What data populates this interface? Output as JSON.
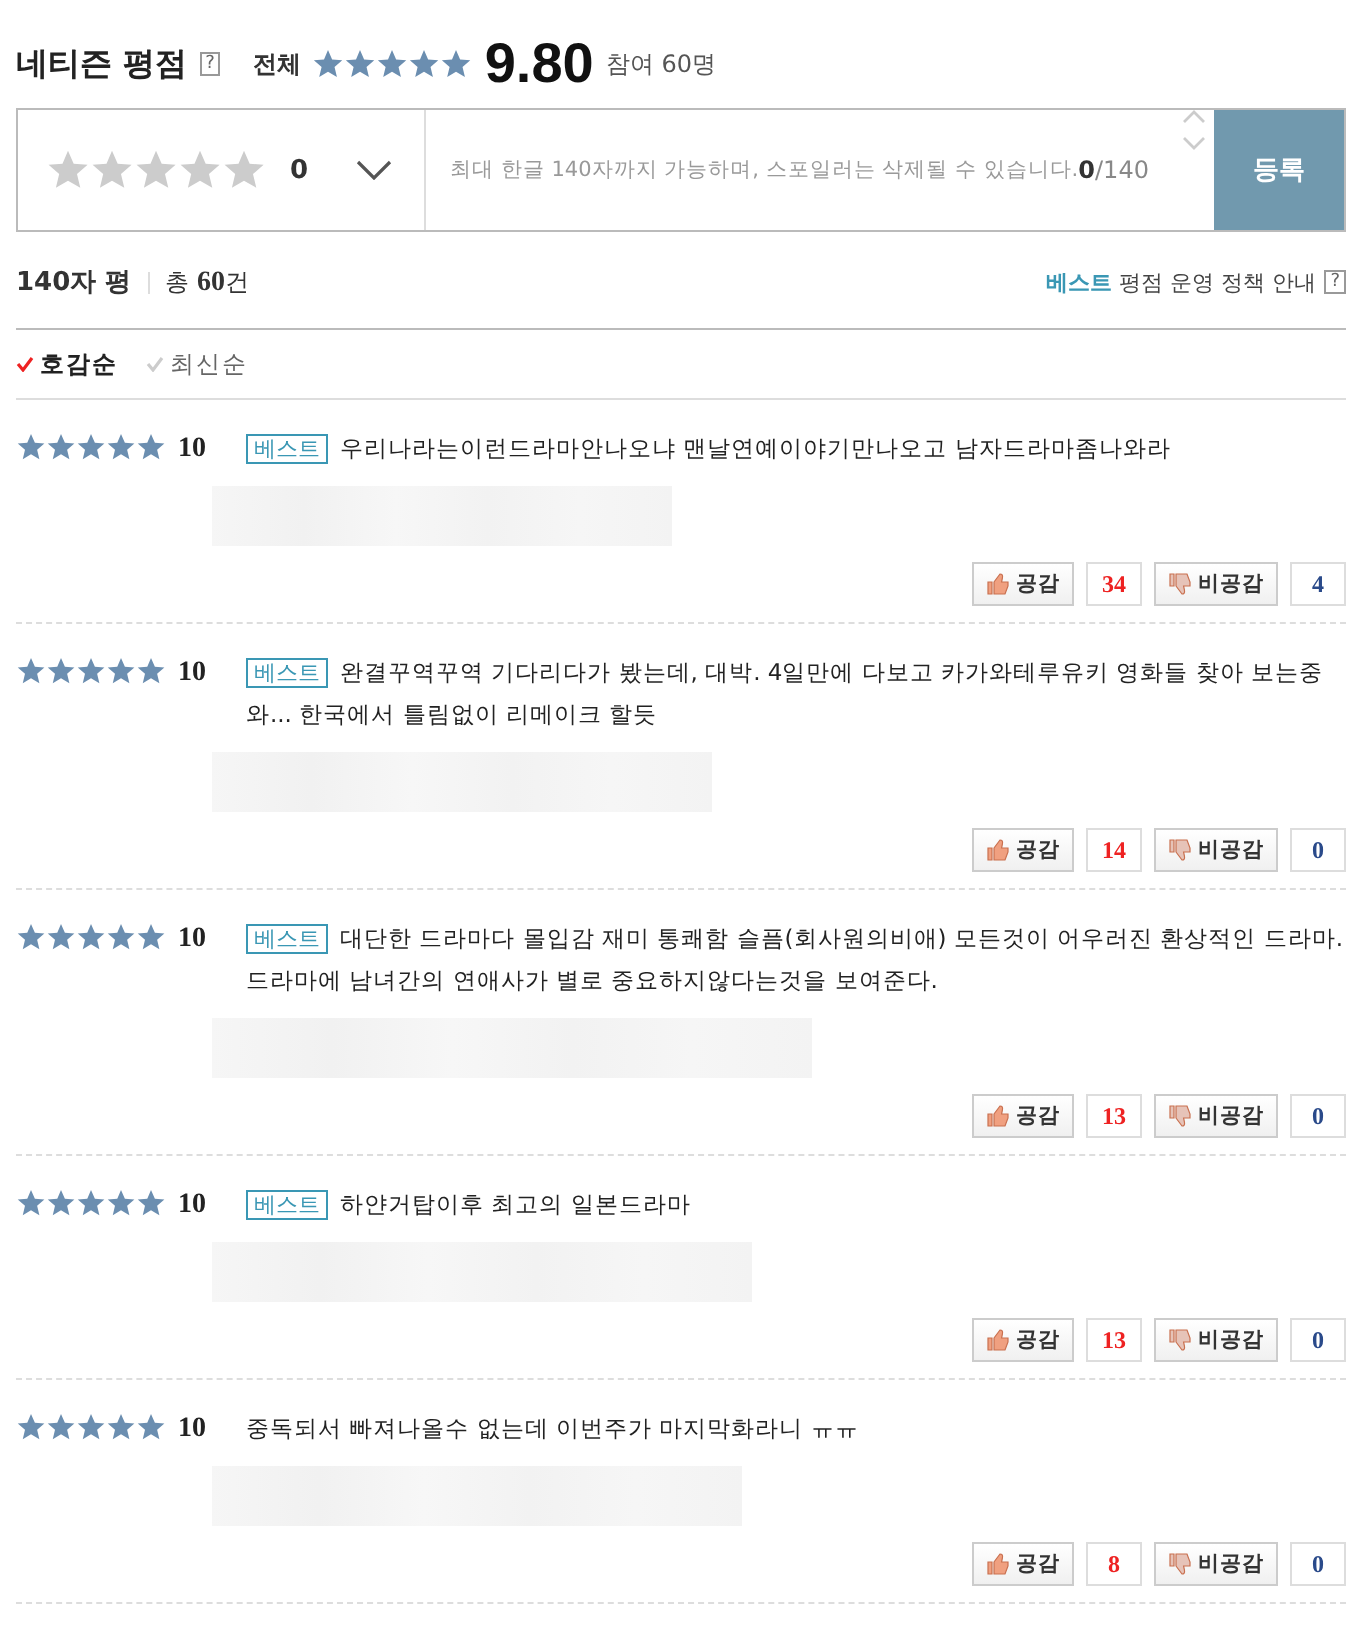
{
  "header": {
    "title": "네티즌 평점",
    "help": "?",
    "scope": "전체",
    "stars": 5,
    "score": "9.80",
    "participants_label": "참여",
    "participants": "60명"
  },
  "compose": {
    "stars": 0,
    "score": "0",
    "placeholder": "최대 한글 140자까지 가능하며, 스포일러는 삭제될 수 있습니다.",
    "count": "0",
    "limit": "/140",
    "submit": "등록"
  },
  "summary": {
    "title": "140자 평",
    "total_label": "총",
    "total": "60",
    "total_unit": "건",
    "policy_highlight": "베스트",
    "policy": "평점 운영 정책 안내",
    "help": "?"
  },
  "sort": [
    {
      "label": "호감순",
      "selected": true
    },
    {
      "label": "최신순",
      "selected": false
    }
  ],
  "reviews": [
    {
      "stars": 5,
      "score": "10",
      "badge": "베스트",
      "text": "우리나라는이런드라마안나오냐 맨날연예이야기만나오고 남자드라마좀나와라",
      "like_label": "공감",
      "likes": "34",
      "dislike_label": "비공감",
      "dislikes": "4"
    },
    {
      "stars": 5,
      "score": "10",
      "badge": "베스트",
      "text": "완결꾸역꾸역 기다리다가 봤는데, 대박. 4일만에 다보고 카가와테루유키 영화들 찾아 보는중 와... 한국에서 틀림없이 리메이크 할듯",
      "like_label": "공감",
      "likes": "14",
      "dislike_label": "비공감",
      "dislikes": "0"
    },
    {
      "stars": 5,
      "score": "10",
      "badge": "베스트",
      "text": "대단한 드라마다 몰입감 재미 통쾌함 슬픔(회사원의비애) 모든것이 어우러진 환상적인 드라마. 드라마에 남녀간의 연애사가 별로 중요하지않다는것을 보여준다.",
      "like_label": "공감",
      "likes": "13",
      "dislike_label": "비공감",
      "dislikes": "0"
    },
    {
      "stars": 5,
      "score": "10",
      "badge": "베스트",
      "text": "하얀거탑이후 최고의 일본드라마",
      "like_label": "공감",
      "likes": "13",
      "dislike_label": "비공감",
      "dislikes": "0"
    },
    {
      "stars": 5,
      "score": "10",
      "text": "중독되서 빠져나올수 없는데 이번주가 마지막화라니 ㅠㅠ",
      "like_label": "공감",
      "likes": "8",
      "dislike_label": "비공감",
      "dislikes": "0"
    }
  ]
}
